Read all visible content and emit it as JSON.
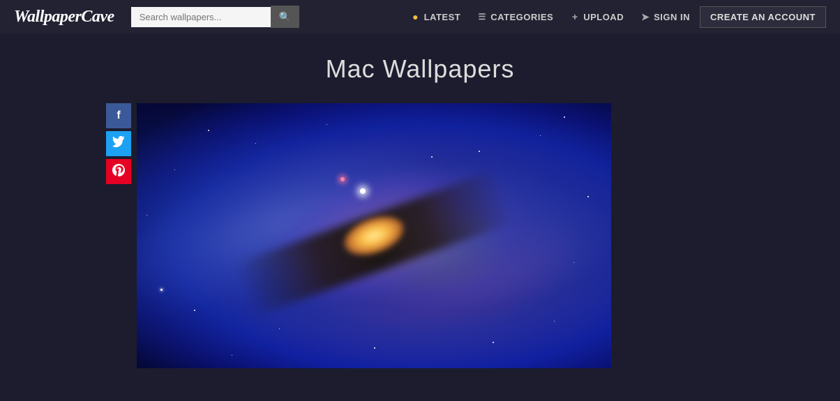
{
  "site": {
    "logo": "WallpaperCave"
  },
  "header": {
    "search_placeholder": "Search wallpapers...",
    "nav": {
      "latest": "LATEST",
      "categories": "CATEGORIES",
      "upload": "UPLOAD",
      "sign_in": "SIGN IN",
      "create_account": "CREATE AN ACCOUNT"
    }
  },
  "page": {
    "title": "Mac Wallpapers"
  },
  "social": {
    "facebook_label": "f",
    "twitter_label": "t",
    "pinterest_label": "p"
  },
  "colors": {
    "navbar_bg": "#222233",
    "body_bg": "#1c1c2e",
    "facebook": "#3b5998",
    "twitter": "#1da1f2",
    "pinterest": "#e60023",
    "create_account_bg": "#2c2c3c"
  }
}
